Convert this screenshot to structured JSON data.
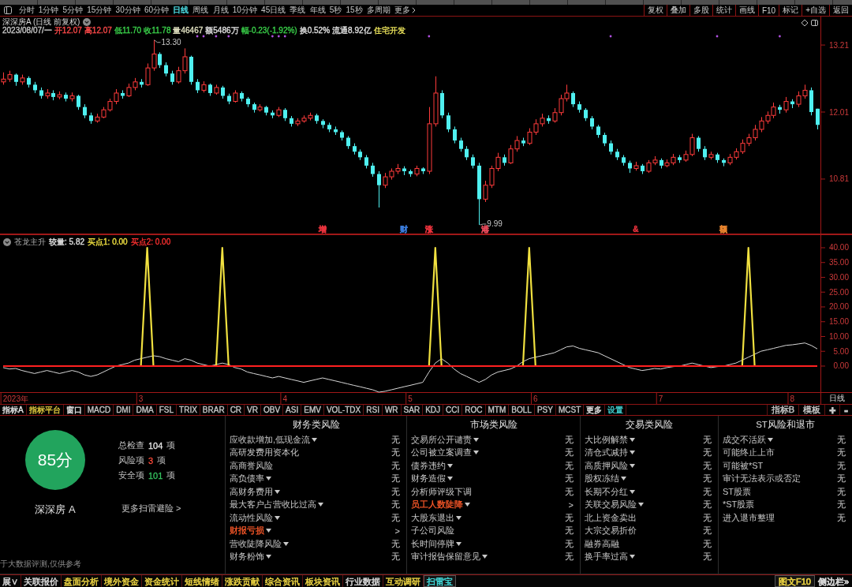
{
  "toolbar": {
    "periods": [
      {
        "label": "分时",
        "selected": false,
        "kind": "period"
      },
      {
        "label": "1分钟",
        "selected": false,
        "kind": "period"
      },
      {
        "label": "5分钟",
        "selected": false,
        "kind": "period"
      },
      {
        "label": "15分钟",
        "selected": false,
        "kind": "period"
      },
      {
        "label": "30分钟",
        "selected": false,
        "kind": "period"
      },
      {
        "label": "60分钟",
        "selected": false,
        "kind": "period"
      },
      {
        "label": "日线",
        "selected": true,
        "kind": "period"
      },
      {
        "label": "周线",
        "selected": false,
        "kind": "period"
      },
      {
        "label": "月线",
        "selected": false,
        "kind": "period"
      },
      {
        "label": "10分钟",
        "selected": false,
        "kind": "period"
      },
      {
        "label": "45日线",
        "selected": false,
        "kind": "period"
      },
      {
        "label": "季线",
        "selected": false,
        "kind": "period"
      },
      {
        "label": "年线",
        "selected": false,
        "kind": "period"
      },
      {
        "label": "5秒",
        "selected": false,
        "kind": "period"
      },
      {
        "label": "15秒",
        "selected": false,
        "kind": "period"
      },
      {
        "label": "多周期",
        "selected": false,
        "kind": "period"
      },
      {
        "label": "更多",
        "selected": false,
        "kind": "menu"
      }
    ],
    "actions": [
      "复权",
      "叠加",
      "多股",
      "统计",
      "画线",
      "F10",
      "标记",
      "+自选",
      "返回"
    ]
  },
  "price_chart": {
    "title": "深深房A (日线 前复权)",
    "quote": [
      {
        "text": "2023/08/07/一",
        "color": "#c8c8c8"
      },
      {
        "text": "开12.07",
        "color": "#ff4a4a"
      },
      {
        "text": "高12.07",
        "color": "#ff4a4a"
      },
      {
        "text": "低11.70",
        "color": "#3ad24a"
      },
      {
        "text": "收11.78",
        "color": "#3ad24a"
      },
      {
        "text": "量46467",
        "color": "#e0e0c0"
      },
      {
        "text": "额5486万",
        "color": "#e0e0e0"
      },
      {
        "text": "幅-0.23(-1.92%)",
        "color": "#3ad24a"
      },
      {
        "text": "换0.52%",
        "color": "#e0e0e0"
      },
      {
        "text": "流通8.92亿",
        "color": "#e0e0e0"
      },
      {
        "text": "住宅开发",
        "color": "#e8e05a"
      }
    ],
    "event_markers": [
      {
        "color": "#e8323c"
      },
      {
        "color": "#3a7ad8"
      },
      {
        "color": "#e8323c"
      },
      {
        "color": "#e84a5a"
      },
      {
        "color": "#e8323c"
      },
      {
        "color": "#e8842e"
      }
    ],
    "chart_data": {
      "type": "candlestick",
      "ylim": [
        9.82,
        13.72
      ],
      "yticks": [
        10.81,
        12.01,
        13.21
      ],
      "annotations": [
        "13.30",
        "9.99"
      ],
      "categories": [
        null,
        null,
        null,
        null,
        null,
        null,
        null,
        null,
        null,
        null,
        null,
        null,
        null,
        null,
        null,
        null,
        null,
        null,
        null,
        null,
        null,
        null,
        null,
        null,
        null,
        null,
        null,
        null,
        null,
        null,
        null,
        null,
        null,
        null,
        null,
        null,
        null,
        null,
        null,
        null,
        null,
        null,
        null,
        null,
        null,
        null,
        null,
        null,
        null,
        null,
        null,
        "增",
        null,
        null,
        null,
        null,
        null,
        null,
        null,
        null,
        null,
        null,
        null,
        null,
        "财",
        null,
        null,
        null,
        "涨",
        null,
        null,
        null,
        null,
        null,
        null,
        null,
        null,
        "港",
        null,
        null,
        null,
        null,
        null,
        null,
        null,
        null,
        null,
        null,
        null,
        null,
        null,
        null,
        null,
        null,
        null,
        null,
        null,
        null,
        null,
        null,
        null,
        "&",
        null,
        null,
        null,
        null,
        null,
        null,
        null,
        null,
        null,
        null,
        null,
        null,
        null,
        "额",
        null,
        null,
        null,
        null,
        null,
        null,
        null,
        null,
        null,
        null,
        null,
        null,
        null,
        null,
        null
      ],
      "ohlc": [
        [
          12.55,
          12.72,
          12.5,
          12.6
        ],
        [
          12.6,
          12.75,
          12.55,
          12.68
        ],
        [
          12.68,
          12.7,
          12.48,
          12.55
        ],
        [
          12.55,
          12.68,
          12.5,
          12.62
        ],
        [
          12.62,
          12.65,
          12.45,
          12.5
        ],
        [
          12.5,
          12.55,
          12.35,
          12.4
        ],
        [
          12.4,
          12.45,
          12.25,
          12.3
        ],
        [
          12.3,
          12.42,
          12.25,
          12.35
        ],
        [
          12.35,
          12.4,
          12.22,
          12.28
        ],
        [
          12.28,
          12.38,
          12.24,
          12.32
        ],
        [
          12.32,
          12.36,
          12.2,
          12.25
        ],
        [
          12.25,
          12.36,
          12.2,
          12.3
        ],
        [
          12.3,
          12.32,
          12.05,
          12.1
        ],
        [
          12.1,
          12.15,
          11.9,
          11.95
        ],
        [
          11.95,
          12.0,
          11.8,
          11.85
        ],
        [
          11.85,
          11.98,
          11.82,
          11.92
        ],
        [
          11.92,
          12.1,
          11.9,
          12.05
        ],
        [
          12.05,
          12.25,
          12.02,
          12.2
        ],
        [
          12.2,
          12.42,
          12.15,
          12.35
        ],
        [
          12.35,
          12.4,
          12.25,
          12.3
        ],
        [
          12.3,
          12.52,
          12.28,
          12.45
        ],
        [
          12.45,
          12.62,
          12.4,
          12.55
        ],
        [
          12.55,
          12.6,
          12.45,
          12.5
        ],
        [
          12.5,
          12.88,
          12.48,
          12.8
        ],
        [
          12.8,
          13.3,
          12.75,
          13.05
        ],
        [
          13.05,
          13.08,
          12.8,
          12.85
        ],
        [
          12.85,
          12.9,
          12.65,
          12.7
        ],
        [
          12.7,
          12.75,
          12.5,
          12.55
        ],
        [
          12.55,
          12.82,
          12.52,
          12.75
        ],
        [
          12.75,
          13.15,
          12.7,
          13.0
        ],
        [
          13.0,
          13.02,
          12.5,
          12.55
        ],
        [
          12.55,
          12.6,
          12.35,
          12.4
        ],
        [
          12.4,
          12.56,
          12.36,
          12.5
        ],
        [
          12.5,
          12.52,
          12.3,
          12.35
        ],
        [
          12.35,
          12.5,
          12.32,
          12.45
        ],
        [
          12.45,
          12.48,
          12.25,
          12.3
        ],
        [
          12.3,
          12.34,
          12.15,
          12.2
        ],
        [
          12.2,
          12.4,
          12.18,
          12.35
        ],
        [
          12.35,
          12.38,
          12.2,
          12.25
        ],
        [
          12.25,
          12.28,
          12.1,
          12.15
        ],
        [
          12.15,
          12.18,
          12.0,
          12.05
        ],
        [
          12.05,
          12.15,
          12.02,
          12.1
        ],
        [
          12.1,
          12.12,
          11.95,
          12.0
        ],
        [
          12.0,
          12.04,
          11.9,
          11.95
        ],
        [
          11.95,
          12.1,
          11.92,
          12.05
        ],
        [
          12.05,
          12.08,
          11.85,
          11.9
        ],
        [
          11.9,
          11.94,
          11.75,
          11.8
        ],
        [
          11.8,
          11.9,
          11.76,
          11.85
        ],
        [
          11.85,
          11.95,
          11.82,
          11.9
        ],
        [
          11.9,
          12.0,
          11.86,
          11.95
        ],
        [
          11.95,
          11.98,
          11.8,
          11.85
        ],
        [
          11.85,
          11.88,
          11.72,
          11.78
        ],
        [
          11.78,
          11.82,
          11.65,
          11.7
        ],
        [
          11.7,
          11.75,
          11.6,
          11.65
        ],
        [
          11.65,
          11.68,
          11.5,
          11.55
        ],
        [
          11.55,
          11.58,
          11.35,
          11.4
        ],
        [
          11.4,
          11.45,
          11.25,
          11.3
        ],
        [
          11.3,
          11.34,
          11.15,
          11.2
        ],
        [
          11.2,
          11.24,
          11.0,
          11.05
        ],
        [
          11.05,
          11.1,
          10.85,
          10.9
        ],
        [
          10.9,
          10.95,
          10.3,
          10.7
        ],
        [
          10.7,
          10.92,
          10.65,
          10.85
        ],
        [
          10.85,
          11.0,
          10.8,
          10.95
        ],
        [
          10.95,
          11.08,
          10.9,
          11.0
        ],
        [
          11.0,
          11.04,
          10.88,
          10.95
        ],
        [
          10.95,
          10.98,
          10.85,
          10.9
        ],
        [
          10.9,
          11.05,
          10.86,
          11.0
        ],
        [
          11.0,
          11.02,
          10.9,
          10.95
        ],
        [
          10.95,
          12.1,
          10.9,
          11.8
        ],
        [
          11.8,
          12.65,
          11.75,
          12.35
        ],
        [
          12.35,
          12.4,
          11.9,
          11.95
        ],
        [
          11.95,
          12.0,
          11.65,
          11.7
        ],
        [
          11.7,
          11.75,
          11.45,
          11.5
        ],
        [
          11.5,
          11.55,
          11.3,
          11.35
        ],
        [
          11.35,
          11.4,
          11.15,
          11.2
        ],
        [
          11.2,
          11.25,
          11.0,
          11.05
        ],
        [
          11.05,
          11.1,
          9.99,
          10.45
        ],
        [
          10.45,
          10.78,
          10.4,
          10.7
        ],
        [
          10.7,
          11.05,
          10.65,
          11.0
        ],
        [
          11.0,
          11.28,
          10.95,
          11.2
        ],
        [
          11.2,
          11.25,
          11.05,
          11.1
        ],
        [
          11.1,
          11.42,
          11.08,
          11.35
        ],
        [
          11.35,
          11.58,
          11.3,
          11.5
        ],
        [
          11.5,
          11.55,
          11.4,
          11.45
        ],
        [
          11.45,
          11.72,
          11.42,
          11.65
        ],
        [
          11.65,
          11.88,
          11.6,
          11.8
        ],
        [
          11.8,
          11.98,
          11.75,
          11.9
        ],
        [
          11.9,
          11.95,
          11.8,
          11.85
        ],
        [
          11.85,
          12.08,
          11.82,
          12.0
        ],
        [
          12.0,
          12.32,
          11.95,
          12.25
        ],
        [
          12.25,
          12.5,
          12.2,
          12.35
        ],
        [
          12.35,
          12.38,
          12.1,
          12.15
        ],
        [
          12.15,
          12.2,
          12.0,
          12.05
        ],
        [
          12.05,
          12.08,
          11.85,
          11.9
        ],
        [
          11.9,
          11.94,
          11.7,
          11.75
        ],
        [
          11.75,
          11.78,
          11.55,
          11.6
        ],
        [
          11.6,
          11.64,
          11.4,
          11.45
        ],
        [
          11.45,
          11.5,
          11.25,
          11.3
        ],
        [
          11.3,
          11.35,
          11.15,
          11.2
        ],
        [
          11.2,
          11.24,
          11.05,
          11.1
        ],
        [
          11.1,
          11.14,
          10.92,
          11.0
        ],
        [
          11.0,
          11.12,
          10.96,
          11.05
        ],
        [
          11.05,
          11.08,
          10.9,
          10.95
        ],
        [
          10.95,
          11.15,
          10.92,
          11.1
        ],
        [
          11.1,
          11.22,
          11.06,
          11.15
        ],
        [
          11.15,
          11.18,
          11.0,
          11.05
        ],
        [
          11.05,
          11.16,
          11.02,
          11.1
        ],
        [
          11.1,
          11.26,
          11.06,
          11.2
        ],
        [
          11.2,
          11.24,
          11.1,
          11.15
        ],
        [
          11.15,
          11.32,
          11.12,
          11.25
        ],
        [
          11.25,
          11.62,
          11.22,
          11.55
        ],
        [
          11.55,
          11.58,
          11.3,
          11.35
        ],
        [
          11.35,
          11.4,
          11.15,
          11.2
        ],
        [
          11.2,
          11.3,
          11.16,
          11.25
        ],
        [
          11.25,
          11.28,
          11.1,
          11.15
        ],
        [
          11.15,
          11.18,
          11.04,
          11.1
        ],
        [
          11.1,
          11.26,
          11.06,
          11.2
        ],
        [
          11.2,
          11.36,
          11.16,
          11.3
        ],
        [
          11.3,
          11.52,
          11.26,
          11.45
        ],
        [
          11.45,
          11.62,
          11.4,
          11.55
        ],
        [
          11.55,
          11.78,
          11.5,
          11.7
        ],
        [
          11.7,
          11.92,
          11.65,
          11.85
        ],
        [
          11.85,
          12.02,
          11.8,
          11.95
        ],
        [
          11.95,
          12.18,
          11.9,
          12.1
        ],
        [
          12.1,
          12.14,
          11.98,
          12.05
        ],
        [
          12.05,
          12.28,
          12.0,
          12.2
        ],
        [
          12.2,
          12.24,
          12.08,
          12.15
        ],
        [
          12.15,
          12.38,
          12.1,
          12.3
        ],
        [
          12.3,
          12.5,
          12.25,
          12.4
        ],
        [
          12.4,
          12.45,
          11.95,
          12.01
        ],
        [
          12.07,
          12.07,
          11.7,
          11.78
        ]
      ]
    }
  },
  "indicator": {
    "name": "苍龙主升",
    "readings": [
      {
        "text": "较量: 5.82",
        "color": "#e0e0e0"
      },
      {
        "text": "买点1: 0.00",
        "color": "#f0e040"
      },
      {
        "text": "买点2: 0.00",
        "color": "#ff3030"
      }
    ],
    "period_label": "日线",
    "chart_data": {
      "type": "line",
      "ylim": [
        -9.07,
        44.53
      ],
      "yticks": [
        {
          "value": 0,
          "label": "0.00"
        },
        {
          "value": 5,
          "label": "5.00"
        },
        {
          "value": 10,
          "label": "10.00"
        },
        {
          "value": 15,
          "label": "15.00"
        },
        {
          "value": 20,
          "label": "20.00"
        },
        {
          "value": 25,
          "label": "25.00"
        },
        {
          "value": 30,
          "label": "30.00"
        },
        {
          "value": 35,
          "label": "35.00"
        },
        {
          "value": 40,
          "label": "40.00"
        }
      ],
      "categories": [
        null,
        null,
        "2023年",
        null,
        null,
        null,
        null,
        null,
        null,
        null,
        null,
        null,
        null,
        null,
        null,
        null,
        null,
        null,
        null,
        null,
        null,
        null,
        "3",
        null,
        null,
        null,
        null,
        null,
        null,
        null,
        null,
        null,
        null,
        null,
        null,
        null,
        null,
        null,
        null,
        null,
        null,
        null,
        null,
        null,
        null,
        "4",
        null,
        null,
        null,
        null,
        null,
        null,
        null,
        null,
        null,
        null,
        null,
        null,
        null,
        null,
        null,
        null,
        null,
        null,
        null,
        "5",
        null,
        null,
        null,
        null,
        null,
        null,
        null,
        null,
        null,
        null,
        null,
        null,
        null,
        null,
        null,
        null,
        null,
        null,
        null,
        "6",
        null,
        null,
        null,
        null,
        null,
        null,
        null,
        null,
        null,
        null,
        null,
        null,
        null,
        null,
        null,
        null,
        null,
        null,
        null,
        "7",
        null,
        null,
        null,
        null,
        null,
        null,
        null,
        null,
        null,
        null,
        null,
        null,
        null,
        null,
        null,
        null,
        null,
        null,
        null,
        null,
        "8",
        null,
        null,
        null,
        null
      ],
      "series": [
        {
          "color": "#d8d8d8",
          "values": [
            -0.5,
            -1,
            -0.8,
            -1.5,
            -2,
            -2.5,
            -2,
            -1.5,
            -2,
            -2.5,
            -2,
            -1.5,
            -2,
            -3,
            -3.5,
            -3,
            -2,
            -1,
            0,
            0.5,
            1,
            2,
            2.5,
            3,
            3.5,
            3.2,
            2.5,
            2,
            1.5,
            2.5,
            2,
            1,
            0.5,
            0,
            0.5,
            1,
            0.5,
            -0.5,
            -1,
            -2,
            -2.5,
            -3,
            -3.5,
            -4,
            -3.5,
            -4,
            -4.5,
            -5,
            -5.5,
            -5,
            -4.5,
            -4,
            -4.5,
            -5,
            -5.5,
            -6,
            -6.5,
            -7,
            -7.5,
            -8,
            -8.8,
            -8.5,
            -8,
            -7.5,
            -7,
            -6.5,
            -6,
            -5.5,
            -2,
            1,
            2.5,
            1,
            -1,
            -2.5,
            -3.5,
            -4.5,
            -5.5,
            -4.5,
            -3,
            -2,
            -1.5,
            -1,
            0,
            1.5,
            2.5,
            3,
            3.5,
            4,
            4.5,
            5.5,
            6.5,
            6.8,
            6,
            5.5,
            5,
            4.5,
            3.5,
            2.5,
            1.5,
            0.5,
            -0.5,
            -1,
            -1.5,
            -1.2,
            -0.8,
            -1,
            -0.5,
            -0.2,
            0,
            0.5,
            1,
            0.5,
            0,
            -0.5,
            -0.2,
            0,
            0.5,
            1,
            2,
            3,
            4,
            5,
            5.5,
            6,
            6.5,
            7,
            7.2,
            7.5,
            7.8,
            7,
            5.8
          ]
        },
        {
          "color": "#f0e040",
          "values": [
            null,
            null,
            null,
            null,
            null,
            null,
            null,
            null,
            null,
            null,
            null,
            null,
            null,
            null,
            null,
            null,
            null,
            null,
            null,
            null,
            null,
            null,
            0,
            40,
            0,
            null,
            null,
            null,
            null,
            null,
            null,
            null,
            null,
            null,
            0,
            40,
            0,
            null,
            null,
            null,
            null,
            null,
            null,
            null,
            null,
            null,
            null,
            null,
            null,
            null,
            null,
            null,
            null,
            null,
            null,
            null,
            null,
            null,
            null,
            null,
            null,
            null,
            null,
            null,
            null,
            null,
            null,
            null,
            0,
            40,
            0,
            null,
            null,
            null,
            null,
            null,
            null,
            null,
            null,
            null,
            null,
            null,
            null,
            0,
            40,
            0,
            null,
            null,
            null,
            null,
            null,
            null,
            null,
            null,
            null,
            null,
            null,
            null,
            null,
            null,
            null,
            null,
            null,
            null,
            null,
            null,
            null,
            null,
            null,
            null,
            null,
            null,
            null,
            null,
            null,
            null,
            null,
            null,
            0,
            40,
            0,
            null,
            null,
            null,
            null,
            null,
            null,
            null,
            null,
            null,
            null
          ]
        },
        {
          "color": "#ff2020",
          "values": [
            0,
            0,
            0,
            0,
            0,
            0,
            0,
            0,
            0,
            0,
            0,
            0,
            0,
            0,
            0,
            0,
            0,
            0,
            0,
            0,
            0,
            0,
            0,
            0,
            0,
            0,
            0,
            0,
            0,
            0,
            0,
            0,
            0,
            0,
            0,
            0,
            0,
            0,
            0,
            0,
            0,
            0,
            0,
            0,
            0,
            0,
            0,
            0,
            0,
            0,
            0,
            0,
            0,
            0,
            0,
            0,
            0,
            0,
            0,
            0,
            0,
            0,
            0,
            0,
            0,
            0,
            0,
            0,
            0,
            0,
            0,
            0,
            0,
            0,
            0,
            0,
            0,
            0,
            0,
            0,
            0,
            0,
            0,
            0,
            0,
            0,
            0,
            0,
            0,
            0,
            0,
            0,
            0,
            0,
            0,
            0,
            0,
            0,
            0,
            0,
            0,
            0,
            0,
            0,
            0,
            0,
            0,
            0,
            0,
            0,
            0,
            0,
            0,
            0,
            0,
            0,
            0,
            0,
            0,
            0,
            0,
            0,
            0,
            0,
            0,
            0,
            0,
            0,
            0,
            0,
            0
          ]
        }
      ]
    }
  },
  "indicator_tabs": {
    "left": [
      {
        "label": "指标A",
        "color": "#e8e8e8"
      },
      {
        "label": "指标平台",
        "color": "#e8d040"
      },
      {
        "label": "窗口",
        "color": "#e8e8e8"
      },
      {
        "label": "MACD",
        "color": "#c8c8c8"
      },
      {
        "label": "DMI",
        "color": "#c8c8c8"
      },
      {
        "label": "DMA",
        "color": "#c8c8c8"
      },
      {
        "label": "FSL",
        "color": "#c8c8c8"
      },
      {
        "label": "TRIX",
        "color": "#c8c8c8"
      },
      {
        "label": "BRAR",
        "color": "#c8c8c8"
      },
      {
        "label": "CR",
        "color": "#c8c8c8"
      },
      {
        "label": "VR",
        "color": "#c8c8c8"
      },
      {
        "label": "OBV",
        "color": "#c8c8c8"
      },
      {
        "label": "ASI",
        "color": "#c8c8c8"
      },
      {
        "label": "EMV",
        "color": "#c8c8c8"
      },
      {
        "label": "VOL-TDX",
        "color": "#c8c8c8"
      },
      {
        "label": "RSI",
        "color": "#c8c8c8"
      },
      {
        "label": "WR",
        "color": "#c8c8c8"
      },
      {
        "label": "SAR",
        "color": "#c8c8c8"
      },
      {
        "label": "KDJ",
        "color": "#c8c8c8"
      },
      {
        "label": "CCI",
        "color": "#c8c8c8"
      },
      {
        "label": "ROC",
        "color": "#c8c8c8"
      },
      {
        "label": "MTM",
        "color": "#c8c8c8"
      },
      {
        "label": "BOLL",
        "color": "#c8c8c8"
      },
      {
        "label": "PSY",
        "color": "#c8c8c8"
      },
      {
        "label": "MCST",
        "color": "#c8c8c8"
      },
      {
        "label": "更多",
        "color": "#e8e8e8"
      },
      {
        "label": "设置",
        "color": "#40d0d0"
      }
    ],
    "right": [
      {
        "label": "指标B",
        "color": "#c8c8c8",
        "kind": "tab"
      },
      {
        "label": "模板",
        "color": "#c8c8c8",
        "kind": "tab"
      },
      {
        "label": "+",
        "color": "#c8c8c8",
        "kind": "symbol"
      },
      {
        "label": "-",
        "color": "#c8c8c8",
        "kind": "symbol"
      }
    ]
  },
  "risk_scan": {
    "score": "85分",
    "stock": "深深房 A",
    "stats": [
      {
        "label": "总检查",
        "value": "104",
        "unit": "项",
        "kind": "total"
      },
      {
        "label": "风险项",
        "value": "3",
        "unit": "项",
        "kind": "risk"
      },
      {
        "label": "安全项",
        "value": "101",
        "unit": "项",
        "kind": "safe"
      }
    ],
    "more_link": "更多扫雷避险 >",
    "disclaimer": "于大数据评测,仅供参考",
    "columns": [
      {
        "title": "财务类风险",
        "items": [
          {
            "label": "应收款增加,低现金流",
            "expandable": true,
            "flagged": false,
            "status": "无"
          },
          {
            "label": "高研发费用资本化",
            "expandable": false,
            "flagged": false,
            "status": "无"
          },
          {
            "label": "高商誉风险",
            "expandable": false,
            "flagged": false,
            "status": "无"
          },
          {
            "label": "高负债率",
            "expandable": true,
            "flagged": false,
            "status": "无"
          },
          {
            "label": "高财务费用",
            "expandable": true,
            "flagged": false,
            "status": "无"
          },
          {
            "label": "最大客户占营收比过高",
            "expandable": true,
            "flagged": false,
            "status": "无"
          },
          {
            "label": "流动性风险",
            "expandable": true,
            "flagged": false,
            "status": "无"
          },
          {
            "label": "财报亏损",
            "expandable": true,
            "flagged": true,
            "status": ">"
          },
          {
            "label": "营收陡降风险",
            "expandable": true,
            "flagged": false,
            "status": "无"
          },
          {
            "label": "财务粉饰",
            "expandable": true,
            "flagged": false,
            "status": "无"
          }
        ]
      },
      {
        "title": "市场类风险",
        "items": [
          {
            "label": "交易所公开谴责",
            "expandable": true,
            "flagged": false,
            "status": "无"
          },
          {
            "label": "公司被立案调查",
            "expandable": true,
            "flagged": false,
            "status": "无"
          },
          {
            "label": "债券违约",
            "expandable": true,
            "flagged": false,
            "status": "无"
          },
          {
            "label": "财务造假",
            "expandable": true,
            "flagged": false,
            "status": "无"
          },
          {
            "label": "分析师评级下调",
            "expandable": false,
            "flagged": false,
            "status": "无"
          },
          {
            "label": "员工人数陡降",
            "expandable": true,
            "flagged": true,
            "status": ">"
          },
          {
            "label": "大股东退出",
            "expandable": true,
            "flagged": false,
            "status": "无"
          },
          {
            "label": "子公司风险",
            "expandable": false,
            "flagged": false,
            "status": "无"
          },
          {
            "label": "长时间停牌",
            "expandable": true,
            "flagged": false,
            "status": "无"
          },
          {
            "label": "审计报告保留意见",
            "expandable": true,
            "flagged": false,
            "status": "无"
          }
        ]
      },
      {
        "title": "交易类风险",
        "items": [
          {
            "label": "大比例解禁",
            "expandable": true,
            "flagged": false,
            "status": "无"
          },
          {
            "label": "清仓式减持",
            "expandable": true,
            "flagged": false,
            "status": "无"
          },
          {
            "label": "高质押风险",
            "expandable": true,
            "flagged": false,
            "status": "无"
          },
          {
            "label": "股权冻结",
            "expandable": true,
            "flagged": false,
            "status": "无"
          },
          {
            "label": "长期不分红",
            "expandable": true,
            "flagged": false,
            "status": "无"
          },
          {
            "label": "关联交易风险",
            "expandable": true,
            "flagged": false,
            "status": "无"
          },
          {
            "label": "北上资金卖出",
            "expandable": false,
            "flagged": false,
            "status": "无"
          },
          {
            "label": "大宗交易折价",
            "expandable": false,
            "flagged": false,
            "status": "无"
          },
          {
            "label": "融券高融",
            "expandable": false,
            "flagged": false,
            "status": "无"
          },
          {
            "label": "换手率过高",
            "expandable": true,
            "flagged": false,
            "status": "无"
          }
        ]
      },
      {
        "title": "ST风险和退市",
        "items": [
          {
            "label": "成交不活跃",
            "expandable": true,
            "flagged": false,
            "status": "无"
          },
          {
            "label": "可能终止上市",
            "expandable": false,
            "flagged": false,
            "status": "无"
          },
          {
            "label": "可能被*ST",
            "expandable": false,
            "flagged": false,
            "status": "无"
          },
          {
            "label": "审计无法表示或否定",
            "expandable": false,
            "flagged": false,
            "status": "无"
          },
          {
            "label": "ST股票",
            "expandable": false,
            "flagged": false,
            "status": "无"
          },
          {
            "label": "*ST股票",
            "expandable": false,
            "flagged": false,
            "status": "无"
          },
          {
            "label": "进入退市整理",
            "expandable": false,
            "flagged": false,
            "status": "无"
          }
        ]
      }
    ]
  },
  "bottom_tabs": {
    "left": [
      {
        "label": "展∨",
        "selected": false,
        "color": "#d8d8d8"
      },
      {
        "label": "关联报价",
        "selected": false,
        "color": "#d8d8d8"
      },
      {
        "label": "盘面分析",
        "selected": false,
        "color": "#e8d040"
      },
      {
        "label": "境外资金",
        "selected": false,
        "color": "#e8d040"
      },
      {
        "label": "资金统计",
        "selected": false,
        "color": "#e8d040"
      },
      {
        "label": "短线情绪",
        "selected": false,
        "color": "#e8d040"
      },
      {
        "label": "涨跌贡献",
        "selected": false,
        "color": "#e8d040"
      },
      {
        "label": "综合资讯",
        "selected": false,
        "color": "#e8d040"
      },
      {
        "label": "板块资讯",
        "selected": false,
        "color": "#e8d040"
      },
      {
        "label": "行业数据",
        "selected": false,
        "color": "#d8d8d8"
      },
      {
        "label": "互动调研",
        "selected": false,
        "color": "#e8d040"
      },
      {
        "label": "扫雷宝",
        "selected": true,
        "color": "#40d8d8"
      }
    ],
    "right": [
      {
        "label": "图文F10",
        "selected": true,
        "color": "#e8d040"
      },
      {
        "label": "侧边栏»",
        "selected": false,
        "color": "#d8d8d8"
      }
    ]
  }
}
